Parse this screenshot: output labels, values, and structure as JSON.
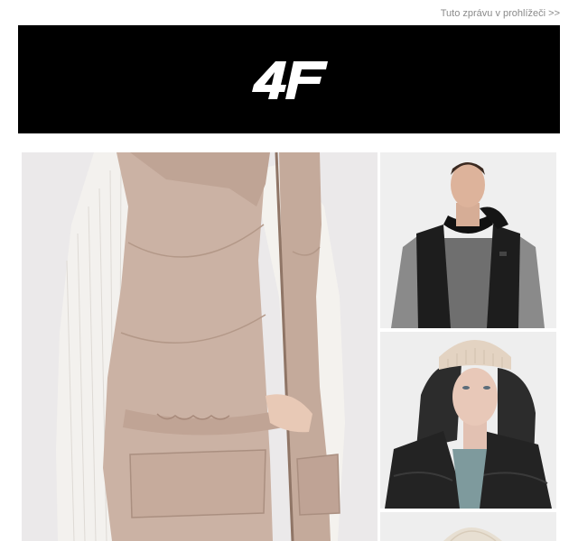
{
  "email": {
    "view_in_browser": "Tuto zprávu v prohlížeči >>"
  },
  "header": {
    "background": "#000000",
    "logo_icon": "4f-logo-icon",
    "logo_color": "#ffffff"
  },
  "products": [
    {
      "icon": "beige-vest-photo-icon",
      "color": "#c8ad9f"
    },
    {
      "icon": "black-vest-man-photo-icon",
      "color": "#1c1c1c"
    },
    {
      "icon": "black-vest-woman-beanie-photo-icon",
      "color": "#2a2a2a"
    },
    {
      "icon": "beige-cap-photo-icon",
      "color": "#e8e0d4"
    }
  ]
}
